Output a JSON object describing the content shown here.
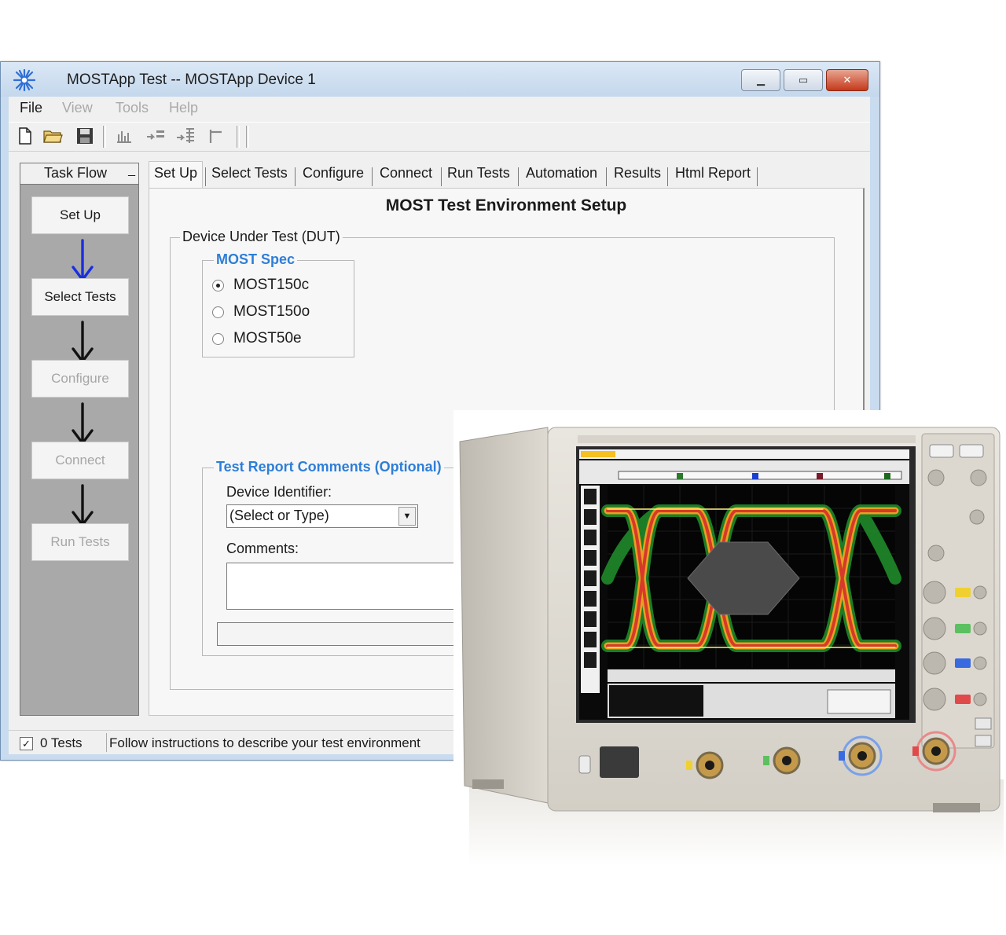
{
  "window": {
    "title": "MOSTApp Test -- MOSTApp Device 1",
    "icon": "agilent-spark-icon"
  },
  "menu": {
    "items": [
      {
        "label": "File",
        "enabled": true
      },
      {
        "label": "View",
        "enabled": false
      },
      {
        "label": "Tools",
        "enabled": false
      },
      {
        "label": "Help",
        "enabled": false
      }
    ]
  },
  "toolbar": {
    "buttons": [
      "new-file-icon",
      "open-folder-icon",
      "save-icon",
      "chart-icon",
      "step-in-icon",
      "step-list-icon",
      "marker-icon"
    ]
  },
  "taskflow": {
    "header": "Task Flow",
    "pin": "_",
    "steps": [
      {
        "label": "Set Up",
        "enabled": true
      },
      {
        "label": "Select Tests",
        "enabled": true
      },
      {
        "label": "Configure",
        "enabled": false
      },
      {
        "label": "Connect",
        "enabled": false
      },
      {
        "label": "Run Tests",
        "enabled": false
      }
    ],
    "active_arrow_color": "#1a2ee0"
  },
  "tabs": [
    {
      "label": "Set Up",
      "active": true
    },
    {
      "label": "Select Tests"
    },
    {
      "label": "Configure"
    },
    {
      "label": "Connect"
    },
    {
      "label": "Run Tests"
    },
    {
      "label": "Automation"
    },
    {
      "label": "Results"
    },
    {
      "label": "Html Report"
    }
  ],
  "setup": {
    "title": "MOST Test Environment Setup",
    "dut_group": "Device Under Test (DUT)",
    "spec_group": "MOST Spec",
    "spec_options": [
      {
        "label": "MOST150c",
        "selected": true
      },
      {
        "label": "MOST150o",
        "selected": false
      },
      {
        "label": "MOST50e",
        "selected": false
      }
    ],
    "comments_group": "Test Report Comments (Optional)",
    "device_identifier_label": "Device Identifier:",
    "device_identifier_value": "(Select or Type)",
    "comments_label": "Comments:",
    "comments_value": ""
  },
  "statusbar": {
    "checked": true,
    "count": "0 Tests",
    "message": "Follow instructions to describe your test environment"
  },
  "colors": {
    "title_bar": "#c9dbee",
    "group_title_blue": "#2e7ed8",
    "close_button": "#c5391b"
  }
}
